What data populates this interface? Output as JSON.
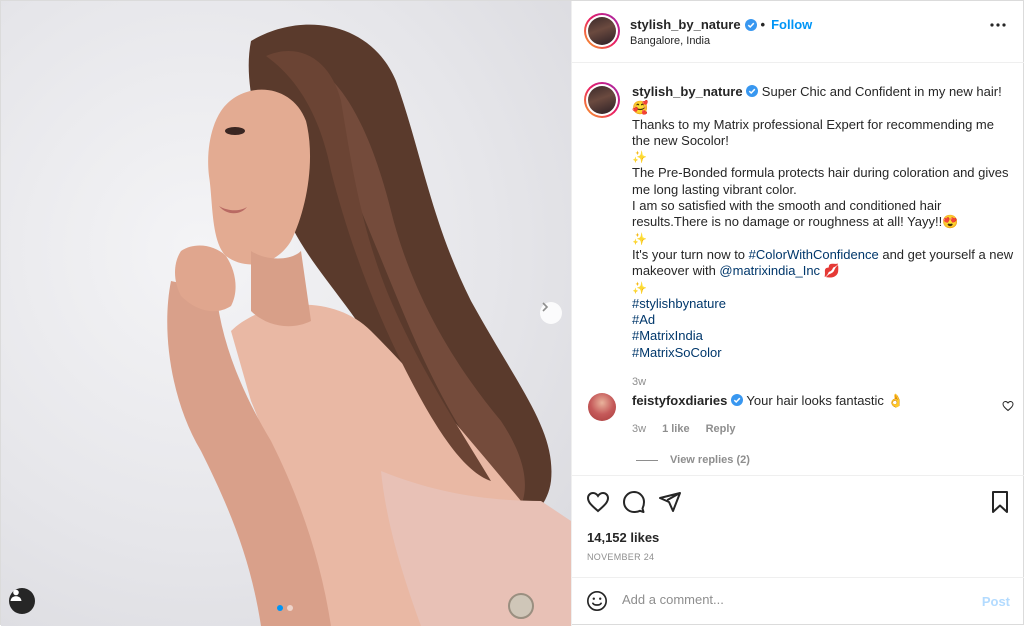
{
  "post": {
    "username": "stylish_by_nature",
    "verified": true,
    "follow_label": "Follow",
    "location": "Bangalore, India",
    "more_icon": "more-horizontal-icon"
  },
  "caption": {
    "username": "stylish_by_nature",
    "line1": "Super Chic and Confident in my new hair! 🥰",
    "line2": "Thanks to my Matrix professional Expert for recommending me the new Socolor!",
    "sparkle": "✨",
    "line3": "The Pre-Bonded formula protects hair during coloration and gives me long lasting vibrant color.",
    "line4": "I am so satisfied with the smooth and conditioned hair results.There is no damage or roughness at all! Yayy!!😍",
    "line5_prefix": "It's your turn now to ",
    "line5_hashtag": "#ColorWithConfidence",
    "line5_mid": " and get yourself a new makeover with ",
    "line5_mention": "@matrixindia_Inc",
    "line5_emoji": " 💋",
    "hashtags": [
      "#stylishbynature",
      "#Ad",
      "#MatrixIndia",
      "#MatrixSoColor"
    ],
    "time": "3w"
  },
  "comment": {
    "username": "feistyfoxdiaries",
    "verified": true,
    "text": "Your hair looks fantastic 👌",
    "time": "3w",
    "likes": "1 like",
    "reply_label": "Reply",
    "view_replies": "View replies (2)"
  },
  "actions": {
    "like_icon": "heart-icon",
    "comment_icon": "comment-icon",
    "share_icon": "share-icon",
    "save_icon": "bookmark-icon",
    "likes_text": "14,152 likes",
    "date": "NOVEMBER 24"
  },
  "add_comment": {
    "placeholder": "Add a comment...",
    "post_label": "Post"
  },
  "carousel": {
    "slide_count": 2,
    "active_index": 0
  },
  "colors": {
    "accent": "#0095f6",
    "link": "#00376b",
    "muted": "#8e8e8e"
  }
}
